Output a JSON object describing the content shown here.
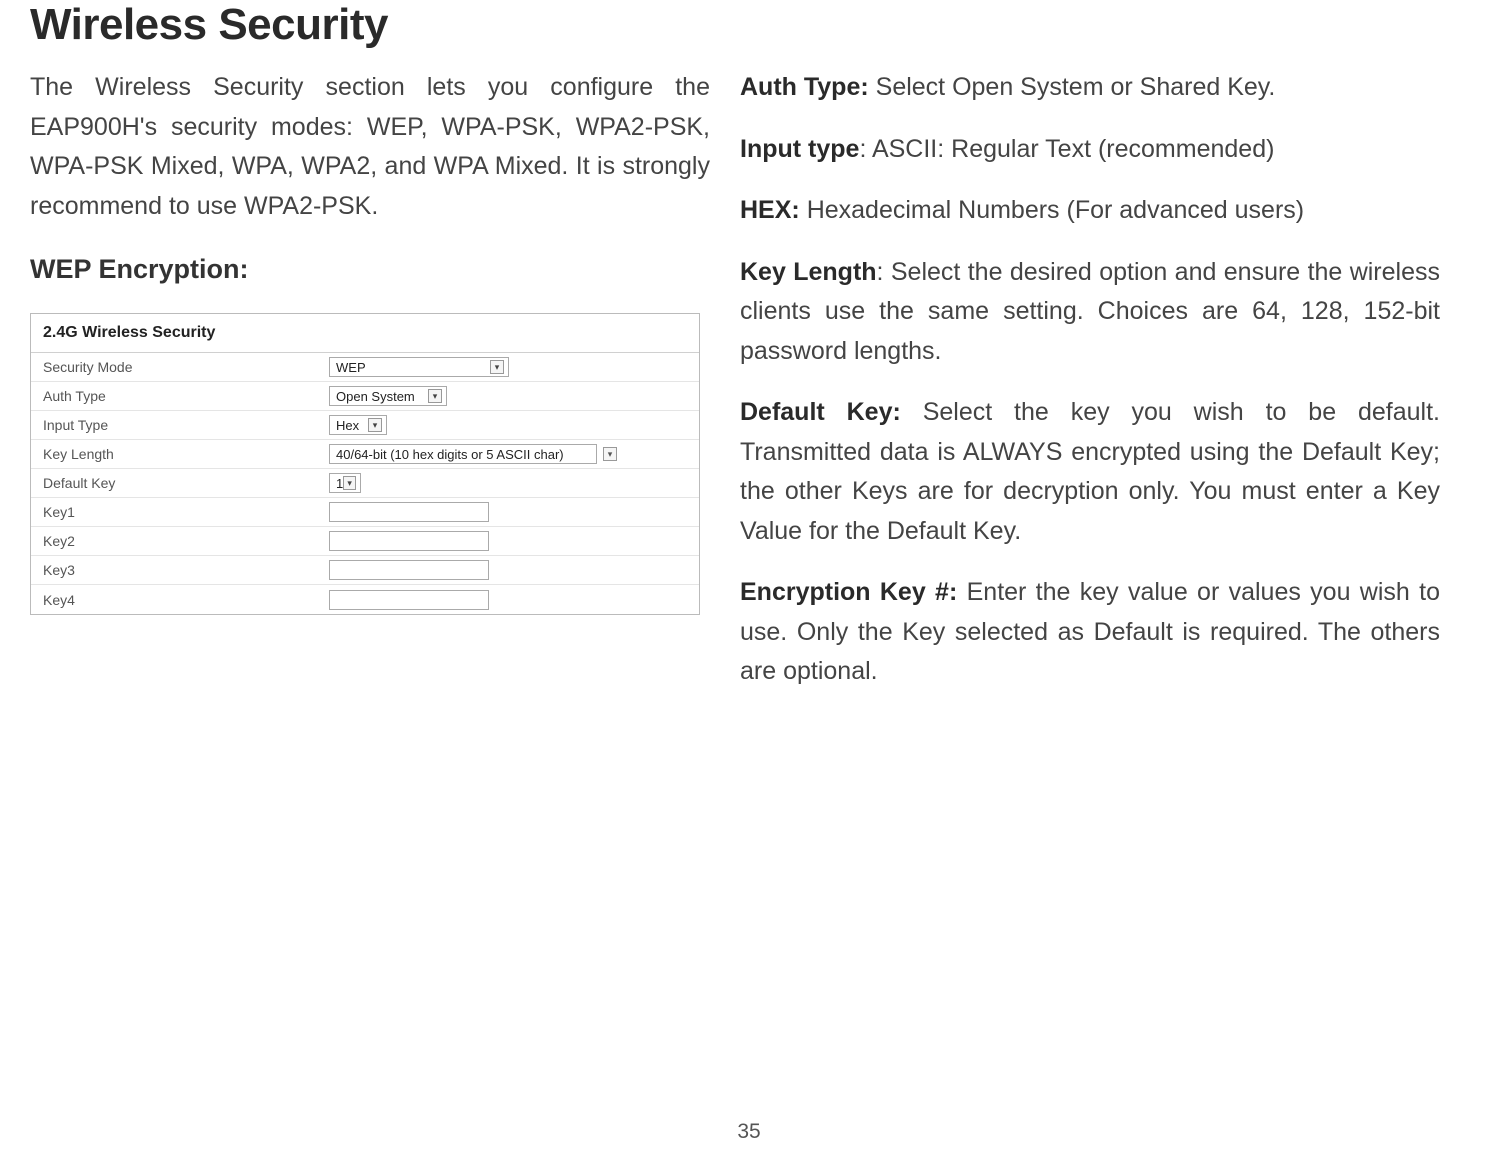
{
  "title": "Wireless Security",
  "intro": "The Wireless Security section lets you configure the EAP900H's security modes: WEP, WPA-PSK, WPA2-PSK, WPA-PSK Mixed, WPA, WPA2, and WPA Mixed. It is strongly recommend to use WPA2-PSK.",
  "subheading": "WEP Encryption:",
  "panel": {
    "title": "2.4G Wireless Security",
    "rows": {
      "security_mode": {
        "label": "Security Mode",
        "value": "WEP"
      },
      "auth_type": {
        "label": "Auth Type",
        "value": "Open System"
      },
      "input_type": {
        "label": "Input Type",
        "value": "Hex"
      },
      "key_length": {
        "label": "Key Length",
        "value": "40/64-bit (10 hex digits or 5 ASCII char)"
      },
      "default_key": {
        "label": "Default Key",
        "value": "1"
      },
      "key1": {
        "label": "Key1"
      },
      "key2": {
        "label": "Key2"
      },
      "key3": {
        "label": "Key3"
      },
      "key4": {
        "label": "Key4"
      }
    }
  },
  "right": {
    "auth_type": {
      "bold": "Auth Type: ",
      "text": "Select Open System or Shared Key."
    },
    "input_type": {
      "bold": "Input type",
      "text": ": ASCII: Regular Text (recommended)"
    },
    "hex": {
      "bold": "HEX: ",
      "text": "Hexadecimal Numbers (For advanced users)"
    },
    "key_length": {
      "bold": "Key Length",
      "text": ": Select the desired option and ensure the wireless clients use the same setting. Choices are 64, 128, 152-bit password lengths."
    },
    "default_key": {
      "bold": "Default Key: ",
      "text": "Select the key you wish to be default. Transmitted data is ALWAYS encrypted using the Default Key; the other Keys are for decryption only. You must enter a Key Value for the Default Key."
    },
    "encryption_key": {
      "bold": "Encryption Key #: ",
      "text": "Enter the key value or values you wish to use. Only the Key selected as Default is required. The others are optional."
    }
  },
  "page_number": "35"
}
